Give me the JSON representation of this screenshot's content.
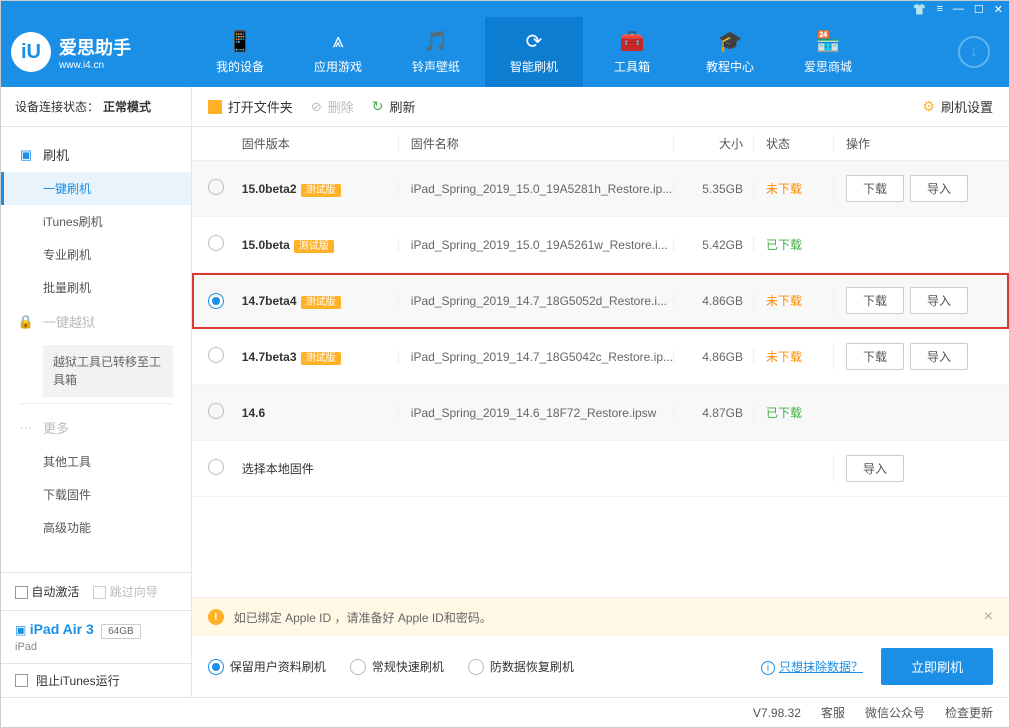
{
  "titlebar_icons": [
    "tshirt",
    "menu",
    "min",
    "max",
    "close"
  ],
  "brand": {
    "name": "爱思助手",
    "site": "www.i4.cn",
    "logo_letter": "iU"
  },
  "nav": [
    {
      "label": "我的设备",
      "icon": "📱"
    },
    {
      "label": "应用游戏",
      "icon": "⩓"
    },
    {
      "label": "铃声壁纸",
      "icon": "🎵"
    },
    {
      "label": "智能刷机",
      "icon": "⟳",
      "active": true
    },
    {
      "label": "工具箱",
      "icon": "🧰"
    },
    {
      "label": "教程中心",
      "icon": "🎓"
    },
    {
      "label": "爱思商城",
      "icon": "🏪"
    }
  ],
  "conn": {
    "label": "设备连接状态：",
    "value": "正常模式"
  },
  "side": {
    "flash_cat": "刷机",
    "flash_items": [
      "一键刷机",
      "iTunes刷机",
      "专业刷机",
      "批量刷机"
    ],
    "jailbreak_cat": "一键越狱",
    "jailbreak_notice": "越狱工具已转移至工具箱",
    "more_cat": "更多",
    "more_items": [
      "其他工具",
      "下载固件",
      "高级功能"
    ]
  },
  "bottom": {
    "auto_activate": "自动激活",
    "skip_guide": "跳过向导",
    "device_name": "iPad Air 3",
    "device_cap": "64GB",
    "device_type": "iPad",
    "block_itunes": "阻止iTunes运行"
  },
  "toolbar": {
    "open": "打开文件夹",
    "delete": "删除",
    "refresh": "刷新",
    "settings": "刷机设置"
  },
  "columns": {
    "ver": "固件版本",
    "name": "固件名称",
    "size": "大小",
    "status": "状态",
    "ops": "操作"
  },
  "badge": "测试版",
  "btn_download": "下载",
  "btn_import": "导入",
  "status_not": "未下载",
  "status_done": "已下载",
  "rows": [
    {
      "ver": "15.0beta2",
      "beta": true,
      "name": "iPad_Spring_2019_15.0_19A5281h_Restore.ip...",
      "size": "5.35GB",
      "status": "not",
      "ops": [
        "download",
        "import"
      ],
      "selected": false
    },
    {
      "ver": "15.0beta",
      "beta": true,
      "name": "iPad_Spring_2019_15.0_19A5261w_Restore.i...",
      "size": "5.42GB",
      "status": "done",
      "ops": [],
      "selected": false
    },
    {
      "ver": "14.7beta4",
      "beta": true,
      "name": "iPad_Spring_2019_14.7_18G5052d_Restore.i...",
      "size": "4.86GB",
      "status": "not",
      "ops": [
        "download",
        "import"
      ],
      "selected": true,
      "highlight": true
    },
    {
      "ver": "14.7beta3",
      "beta": true,
      "name": "iPad_Spring_2019_14.7_18G5042c_Restore.ip...",
      "size": "4.86GB",
      "status": "not",
      "ops": [
        "download",
        "import"
      ],
      "selected": false
    },
    {
      "ver": "14.6",
      "beta": false,
      "name": "iPad_Spring_2019_14.6_18F72_Restore.ipsw",
      "size": "4.87GB",
      "status": "done",
      "ops": [],
      "selected": false
    }
  ],
  "local_row": "选择本地固件",
  "warning": "如已绑定 Apple ID ，请准备好 Apple ID和密码。",
  "flash_opts": [
    "保留用户资料刷机",
    "常规快速刷机",
    "防数据恢复刷机"
  ],
  "erase_link": "只想抹除数据？",
  "flash_now": "立即刷机",
  "footer": {
    "version": "V7.98.32",
    "service": "客服",
    "wechat": "微信公众号",
    "update": "检查更新"
  }
}
